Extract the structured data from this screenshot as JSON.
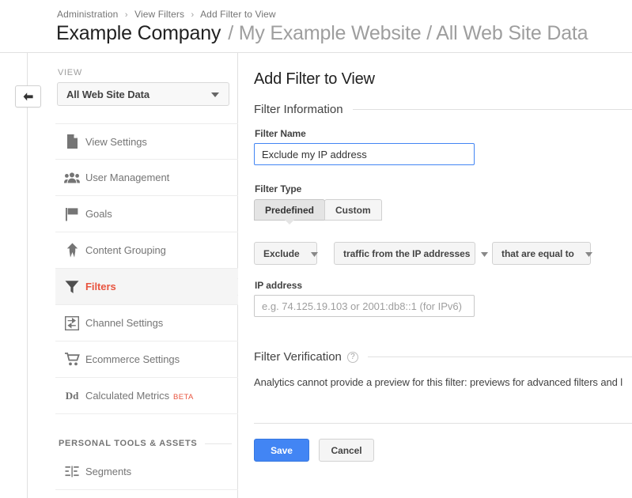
{
  "header": {
    "breadcrumb": [
      "Administration",
      "View Filters",
      "Add Filter to View"
    ],
    "breadcrumb_separator": "›",
    "account_name": "Example Company",
    "property_and_view": "/ My Example Website / All Web Site Data"
  },
  "back_button": {
    "label": "back-arrow",
    "icon": "arrow-left-icon"
  },
  "sidebar": {
    "view_label": "VIEW",
    "view_selected": "All Web Site Data",
    "view_caret_icon": "chevron-down-icon",
    "items": [
      {
        "label": "View Settings",
        "icon": "document-icon",
        "active": false
      },
      {
        "label": "User Management",
        "icon": "people-icon",
        "active": false
      },
      {
        "label": "Goals",
        "icon": "flag-icon",
        "active": false
      },
      {
        "label": "Content Grouping",
        "icon": "arrow-up-merge-icon",
        "active": false
      },
      {
        "label": "Filters",
        "icon": "funnel-icon",
        "active": true
      },
      {
        "label": "Channel Settings",
        "icon": "channel-arrows-icon",
        "active": false
      },
      {
        "label": "Ecommerce Settings",
        "icon": "shopping-cart-icon",
        "active": false
      },
      {
        "label": "Calculated Metrics",
        "icon": "dd-text-icon",
        "badge": "BETA",
        "active": false
      }
    ],
    "section_heading": "PERSONAL TOOLS & ASSETS",
    "personal_items": [
      {
        "label": "Segments",
        "icon": "segments-icon",
        "active": false
      }
    ]
  },
  "main": {
    "page_title": "Add Filter to View",
    "filter_information": {
      "section_label": "Filter Information",
      "filter_name_label": "Filter Name",
      "filter_name_value": "Exclude my IP address",
      "filter_type_label": "Filter Type",
      "tabs": [
        {
          "label": "Predefined",
          "selected": true
        },
        {
          "label": "Custom",
          "selected": false
        }
      ],
      "dropdowns": [
        {
          "name": "filter-verb",
          "value": "Exclude",
          "icon": "chevron-down-icon"
        },
        {
          "name": "filter-field",
          "value": "traffic from the IP addresses",
          "icon": "chevron-down-icon"
        },
        {
          "name": "filter-match",
          "value": "that are equal to",
          "icon": "chevron-down-icon"
        }
      ],
      "ip_address_label": "IP address",
      "ip_address_value": "",
      "ip_address_placeholder": "e.g. 74.125.19.103 or 2001:db8::1 (for IPv6)"
    },
    "filter_verification": {
      "section_label": "Filter Verification",
      "help_icon": "question-mark-icon",
      "help_icon_glyph": "?",
      "body_text": "Analytics cannot provide a preview for this filter: previews for advanced filters and l"
    },
    "actions": {
      "save_label": "Save",
      "cancel_label": "Cancel"
    }
  },
  "colors": {
    "accent_orange": "#e8543f",
    "primary_blue": "#4285f4",
    "text_dark": "#212121",
    "text_muted": "#757575",
    "border": "#e0e0e0"
  }
}
